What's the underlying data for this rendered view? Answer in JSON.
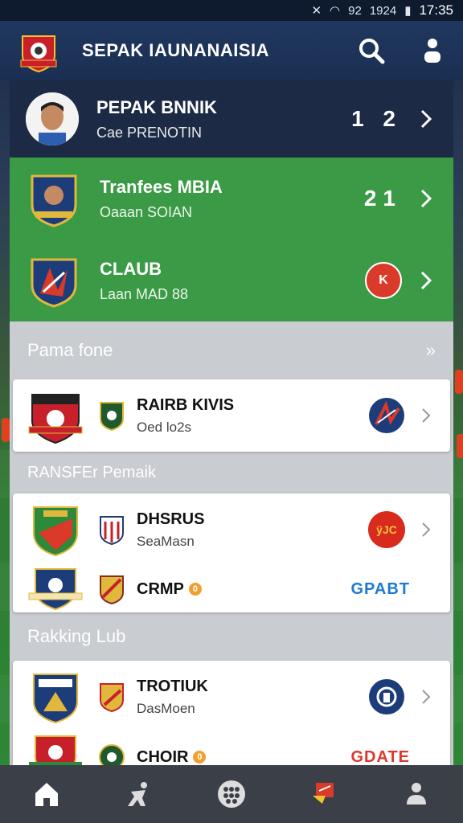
{
  "status": {
    "time": "17:35",
    "signal": "92",
    "label2": "1924"
  },
  "appbar": {
    "title": "SEPAK IAUNANAISIA"
  },
  "hero": {
    "title": "PEPAK BNNIK",
    "subtitle": "Cae PRENOTIN",
    "value": "1 2"
  },
  "transfer": {
    "title": "Tranfees MBIA",
    "subtitle": "Oaaan SOIAN",
    "value": "21"
  },
  "club": {
    "title": "CLAUB",
    "subtitle": "Laan MAD 88",
    "badge": "K"
  },
  "section1": {
    "label": "Pama fone",
    "more": "»"
  },
  "card1": {
    "title": "RAIRB KIVIS",
    "subtitle": "Oed lo2s"
  },
  "section2": {
    "label": "RANSFEr Pemaik"
  },
  "card2": {
    "row1": {
      "title": "DHSRUS",
      "subtitle": "SeaMasn",
      "badge": "ÿJC"
    },
    "row2": {
      "title": "CRMP",
      "coin": "0",
      "right": "GPABT"
    }
  },
  "section3": {
    "label": "Rakking Lub"
  },
  "card3": {
    "row1": {
      "title": "TROTIUK",
      "subtitle": "DasMoen"
    },
    "row2": {
      "title": "CHOIR",
      "coin": "0",
      "right": "GDATE"
    }
  },
  "colors": {
    "green": "#3b9a45",
    "navy": "#1c2a45",
    "accent": "#d93a2a",
    "blue": "#1f7ad0"
  },
  "nav": [
    "home-icon",
    "player-icon",
    "grid-icon",
    "transfer-icon",
    "profile-icon"
  ]
}
